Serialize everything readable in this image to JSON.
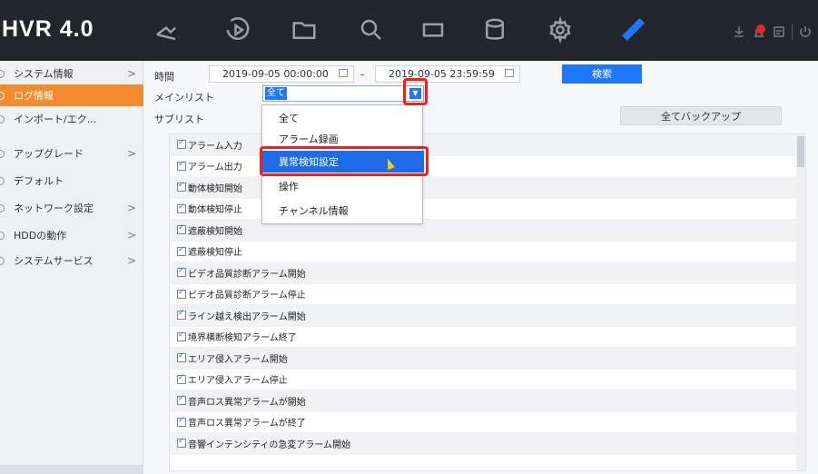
{
  "app": {
    "title": "HVR 4.0"
  },
  "topbar": {
    "icons": [
      "camera-icon",
      "playback-icon",
      "folder-icon",
      "search-icon",
      "display-icon",
      "database-icon",
      "gear-icon",
      "wrench-icon"
    ],
    "active_icon": "wrench-icon",
    "small_icons": [
      "download-icon",
      "alarm-icon",
      "info-icon",
      "power-icon"
    ]
  },
  "sidebar": {
    "items": [
      {
        "label": "システム情報",
        "chevron": ">"
      },
      {
        "label": "ログ情報",
        "chevron": ""
      },
      {
        "label": "インポート/エク...",
        "chevron": ""
      },
      {
        "label": "アップグレード",
        "chevron": ">"
      },
      {
        "label": "デフォルト",
        "chevron": ""
      },
      {
        "label": "ネットワーク設定",
        "chevron": ">"
      },
      {
        "label": "HDDの動作",
        "chevron": ">"
      },
      {
        "label": "システムサービス",
        "chevron": ">"
      }
    ],
    "active_index": 1
  },
  "filters": {
    "time_label": "時間",
    "start_time": "2019-09-05 00:00:00",
    "end_time": "2019-09-05 23:59:59",
    "range_dash": "-",
    "search_button": "検索",
    "main_list_label": "メインリスト",
    "main_list_value": "全て",
    "sub_list_label": "サブリスト",
    "backup_button": "全てバックアップ"
  },
  "dropdown": {
    "options": [
      "全て",
      "アラーム録画",
      "異常検知設定",
      "操作",
      "チャンネル情報"
    ],
    "highlighted": "異常検知設定"
  },
  "sublist": {
    "items": [
      "アラーム入力",
      "アラーム出力",
      "動体検知開始",
      "動体検知停止",
      "遮蔽検知開始",
      "遮蔽検知停止",
      "ビデオ品質診断アラーム開始",
      "ビデオ品質診断アラーム停止",
      "ライン越え検出アラーム開始",
      "境界横断検知アラーム終了",
      "エリア侵入アラーム開始",
      "エリア侵入アラーム停止",
      "音声ロス異常アラームが開始",
      "音声ロス異常アラームが終了",
      "音響インテンシティの急変アラーム開始"
    ]
  },
  "colors": {
    "topbar_bg": "#22252b",
    "accent": "#1e78ff",
    "active_sidebar": "#f28a2e",
    "annotation_red": "#ff1a1a"
  }
}
